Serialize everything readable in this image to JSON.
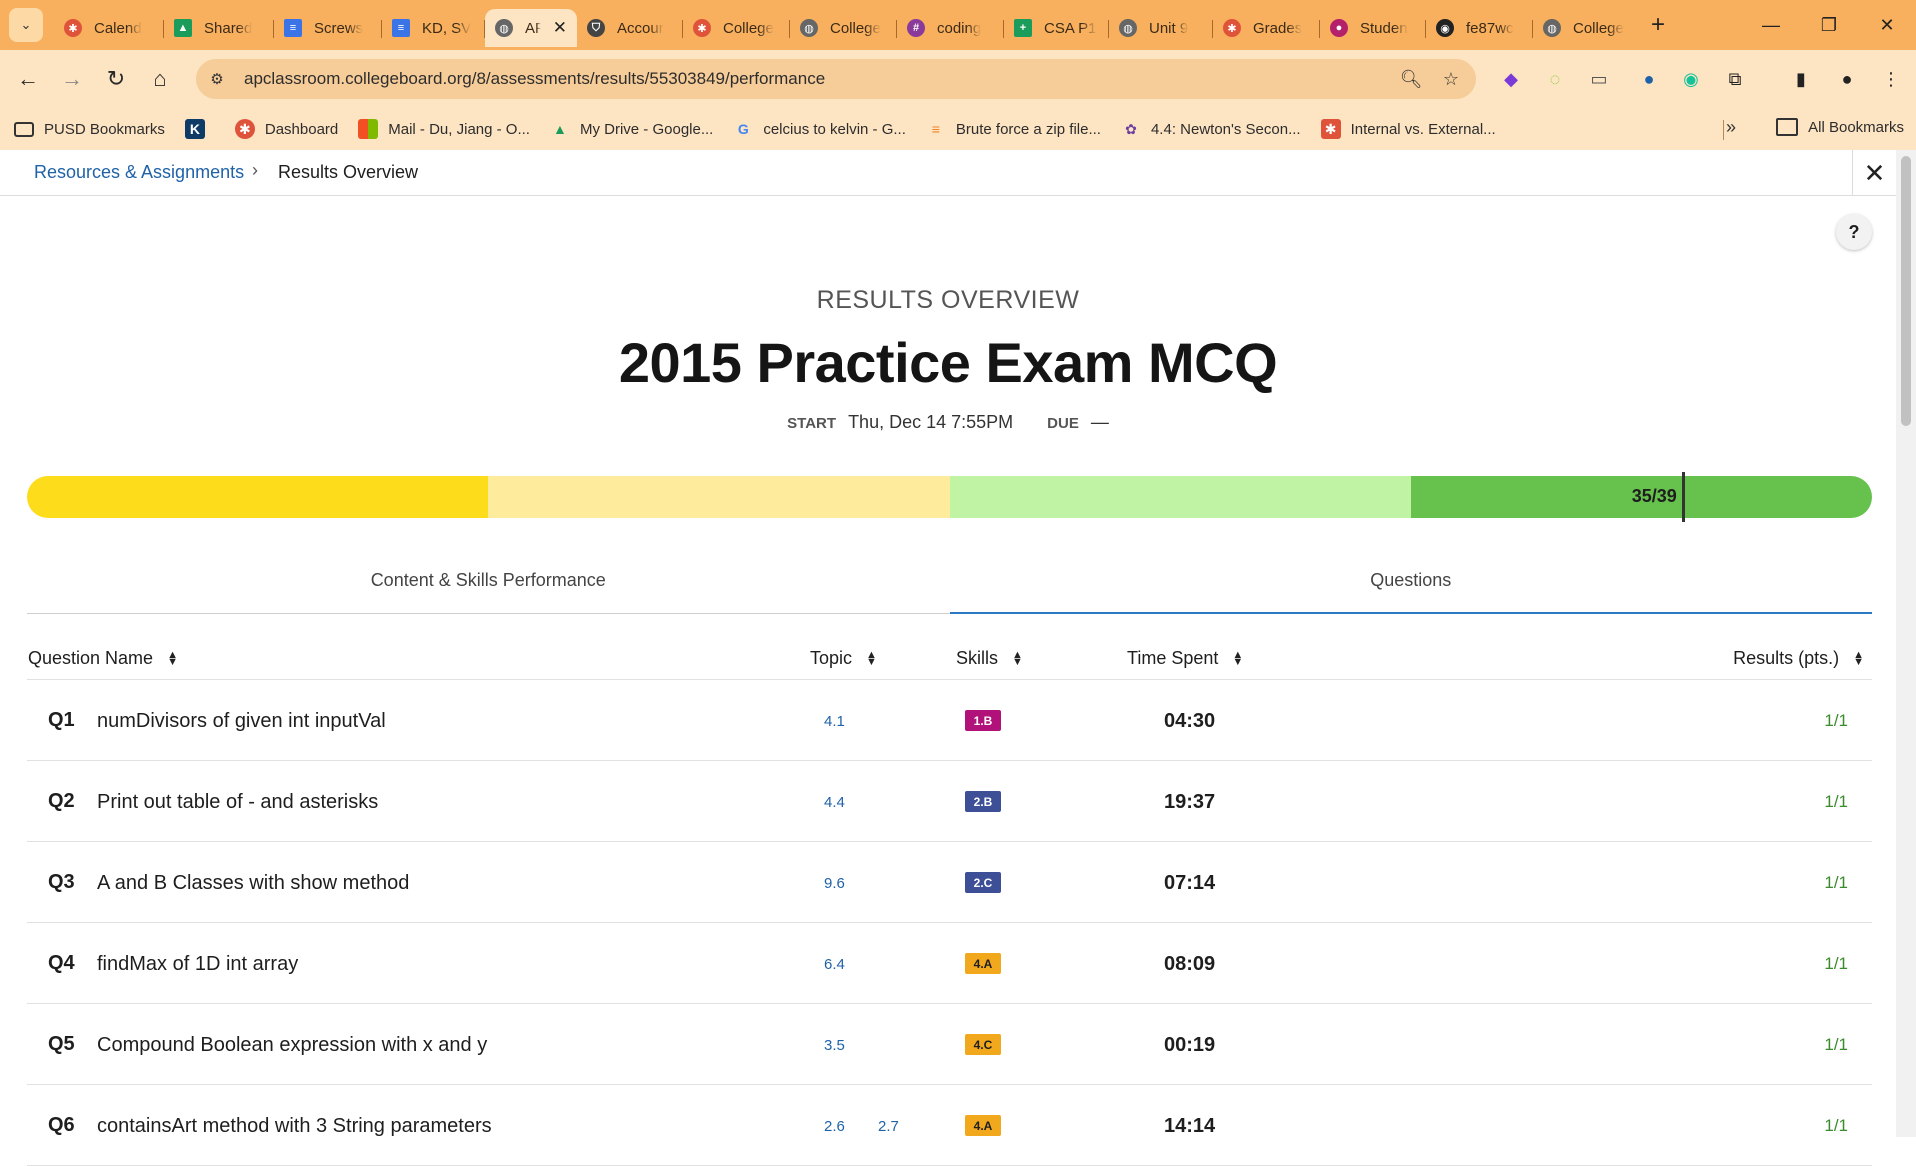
{
  "browser": {
    "tabs": [
      {
        "label": "Calend",
        "icon": "calendar-icon",
        "color": "#e0533b"
      },
      {
        "label": "Shared",
        "icon": "drive-icon",
        "color": "#1a9c5a"
      },
      {
        "label": "Screws",
        "icon": "docs-icon",
        "color": "#3b74e6"
      },
      {
        "label": "KD, SV",
        "icon": "docs-icon",
        "color": "#3b74e6"
      },
      {
        "label": "AP",
        "icon": "globe-icon",
        "color": "#555555",
        "active": true
      },
      {
        "label": "Accour",
        "icon": "shield-icon",
        "color": "#333333"
      },
      {
        "label": "College",
        "icon": "calendar-icon",
        "color": "#e0533b"
      },
      {
        "label": "College",
        "icon": "globe-icon",
        "color": "#555555"
      },
      {
        "label": "coding",
        "icon": "slack-icon",
        "color": "#8a3a9a"
      },
      {
        "label": "CSA P1",
        "icon": "sheets-icon",
        "color": "#1a9c5a"
      },
      {
        "label": "Unit 9",
        "icon": "globe-icon",
        "color": "#555555"
      },
      {
        "label": "Grades",
        "icon": "calendar-icon",
        "color": "#e0533b"
      },
      {
        "label": "Studen",
        "icon": "app-icon",
        "color": "#b5206a"
      },
      {
        "label": "fe87wc",
        "icon": "github-icon",
        "color": "#222222"
      },
      {
        "label": "College",
        "icon": "globe-icon",
        "color": "#555555"
      }
    ],
    "url": "apclassroom.collegeboard.org/8/assessments/results/55303849/performance",
    "bookmarks": [
      {
        "label": "PUSD Bookmarks",
        "icon": "folder-icon"
      },
      {
        "label": "",
        "icon": "k-icon"
      },
      {
        "label": "Dashboard",
        "icon": "calendar-icon"
      },
      {
        "label": "Mail - Du, Jiang - O...",
        "icon": "microsoft-icon"
      },
      {
        "label": "My Drive - Google...",
        "icon": "drive-icon"
      },
      {
        "label": "celcius to kelvin - G...",
        "icon": "google-icon"
      },
      {
        "label": "Brute force a zip file...",
        "icon": "stackoverflow-icon"
      },
      {
        "label": "4.4: Newton's Secon...",
        "icon": "atom-icon"
      },
      {
        "label": "Internal vs. External...",
        "icon": "square-icon"
      }
    ],
    "all_bookmarks": "All Bookmarks"
  },
  "breadcrumb": {
    "link": "Resources & Assignments",
    "current": "Results Overview"
  },
  "header": {
    "overline": "RESULTS OVERVIEW",
    "title": "2015 Practice Exam MCQ",
    "start_label": "START",
    "start_value": "Thu, Dec 14 7:55PM",
    "due_label": "DUE",
    "due_value": "—"
  },
  "score": {
    "label": "35/39",
    "earned": 35,
    "possible": 39,
    "bands": [
      "#fddc1c",
      "#feeb9c",
      "#c0f4a4",
      "#66c14d"
    ]
  },
  "tabs": [
    {
      "label": "Content & Skills Performance",
      "active": false
    },
    {
      "label": "Questions",
      "active": true
    }
  ],
  "table": {
    "columns": [
      "Question Name",
      "Topic",
      "Skills",
      "Time Spent",
      "Results (pts.)"
    ],
    "rows": [
      {
        "num": "Q1",
        "name": "numDivisors of given int inputVal",
        "topics": [
          "4.1"
        ],
        "skill": "1.B",
        "skill_color": "#b0127a",
        "time": "04:30",
        "result": "1/1"
      },
      {
        "num": "Q2",
        "name": "Print out table of - and asterisks",
        "topics": [
          "4.4"
        ],
        "skill": "2.B",
        "skill_color": "#3d4f97",
        "time": "19:37",
        "result": "1/1"
      },
      {
        "num": "Q3",
        "name": "A and B Classes with show method",
        "topics": [
          "9.6"
        ],
        "skill": "2.C",
        "skill_color": "#3d4f97",
        "time": "07:14",
        "result": "1/1"
      },
      {
        "num": "Q4",
        "name": "findMax of 1D int array",
        "topics": [
          "6.4"
        ],
        "skill": "4.A",
        "skill_color": "#f2a81d",
        "time": "08:09",
        "result": "1/1"
      },
      {
        "num": "Q5",
        "name": "Compound Boolean expression with x and y",
        "topics": [
          "3.5"
        ],
        "skill": "4.C",
        "skill_color": "#f2a81d",
        "time": "00:19",
        "result": "1/1"
      },
      {
        "num": "Q6",
        "name": "containsArt method with 3 String parameters",
        "topics": [
          "2.6",
          "2.7"
        ],
        "skill": "4.A",
        "skill_color": "#f2a81d",
        "time": "14:14",
        "result": "1/1"
      }
    ]
  },
  "colors": {
    "link": "#1f62a8",
    "result": "#3b8b2d",
    "tab_active": "#2b79c2",
    "chrome": "#f8b05e"
  }
}
